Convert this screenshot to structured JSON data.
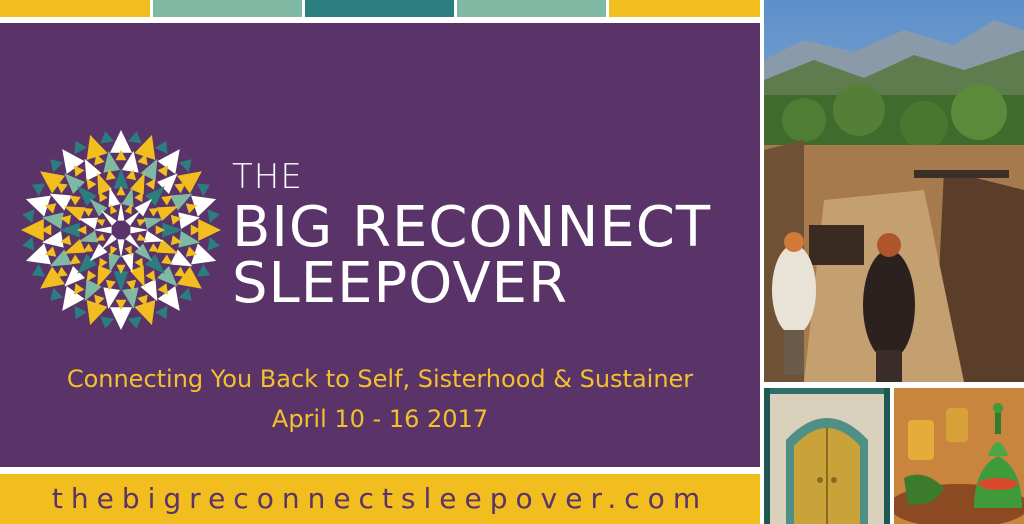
{
  "header": {
    "title_line1": "THE",
    "title_line2": "BIG RECONNECT",
    "title_line3": "SLEEPOVER"
  },
  "main": {
    "tagline": "Connecting You Back to Self, Sisterhood & Sustainer",
    "dates": "April 10 - 16 2017"
  },
  "footer": {
    "url": "thebigreconnectsleepover.com"
  },
  "colors": {
    "purple": "#5a3468",
    "gold": "#f2bd1f",
    "teal_light": "#7fb9a3",
    "teal_dark": "#2b7d80",
    "white": "#ffffff"
  }
}
